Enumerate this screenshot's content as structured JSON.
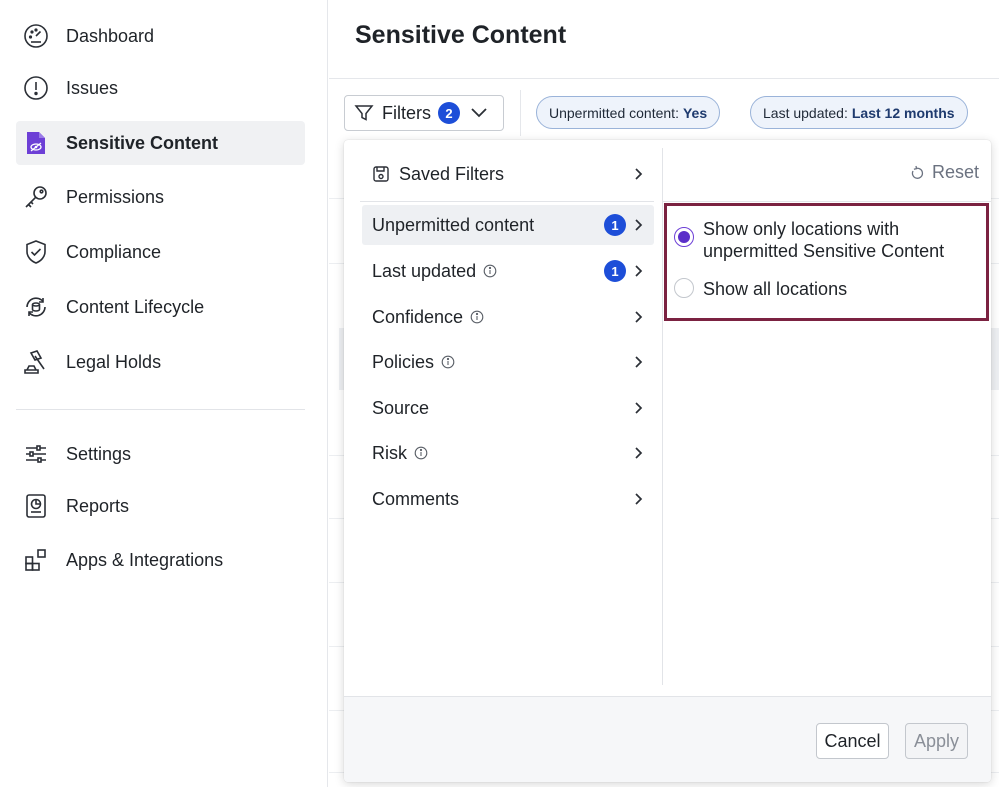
{
  "sidebar": {
    "items": [
      {
        "label": "Dashboard",
        "icon": "dashboard-gauge-icon"
      },
      {
        "label": "Issues",
        "icon": "alert-circle-icon"
      },
      {
        "label": "Sensitive Content",
        "icon": "sensitive-file-icon",
        "active": true
      },
      {
        "label": "Permissions",
        "icon": "key-icon"
      },
      {
        "label": "Compliance",
        "icon": "shield-check-icon"
      },
      {
        "label": "Content Lifecycle",
        "icon": "lifecycle-icon"
      },
      {
        "label": "Legal Holds",
        "icon": "gavel-icon"
      },
      {
        "label": "Settings",
        "icon": "sliders-icon"
      },
      {
        "label": "Reports",
        "icon": "report-icon"
      },
      {
        "label": "Apps & Integrations",
        "icon": "apps-grid-icon"
      }
    ]
  },
  "header": {
    "title": "Sensitive Content"
  },
  "toolbar": {
    "filters_label": "Filters",
    "filters_count": "2",
    "chips": [
      {
        "key": "Unpermitted content:",
        "value": "Yes"
      },
      {
        "key": "Last updated:",
        "value": "Last 12 months"
      }
    ]
  },
  "filter_menu": {
    "saved_filters_label": "Saved Filters",
    "items": [
      {
        "label": "Unpermitted content",
        "count": "1",
        "info": false,
        "active": true
      },
      {
        "label": "Last updated",
        "count": "1",
        "info": true
      },
      {
        "label": "Confidence",
        "count": null,
        "info": true
      },
      {
        "label": "Policies",
        "count": null,
        "info": true
      },
      {
        "label": "Source",
        "count": null,
        "info": false
      },
      {
        "label": "Risk",
        "count": null,
        "info": true
      },
      {
        "label": "Comments",
        "count": null,
        "info": false
      }
    ],
    "reset_label": "Reset",
    "options": [
      {
        "label": "Show only locations with unpermitted Sensitive Content",
        "selected": true
      },
      {
        "label": "Show all locations",
        "selected": false
      }
    ],
    "cancel_label": "Cancel",
    "apply_label": "Apply"
  },
  "colors": {
    "accent": "#5b2fc9",
    "badge": "#1d4ed8",
    "highlight_border": "#7b2241",
    "chip_bg": "#eef3fb"
  }
}
